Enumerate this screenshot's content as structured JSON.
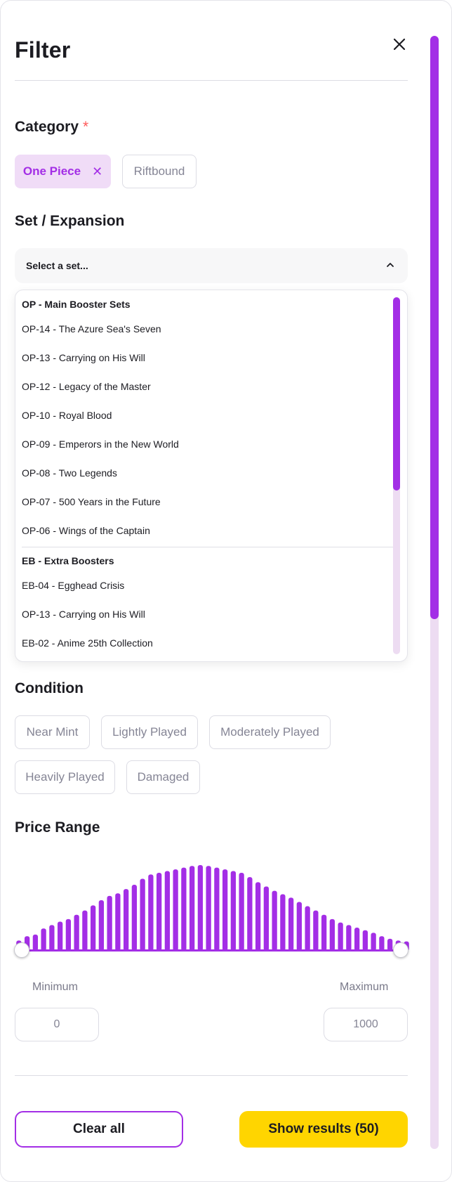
{
  "header": {
    "title": "Filter",
    "close_icon": "close-icon"
  },
  "category": {
    "title": "Category",
    "required_marker": "*",
    "chips": [
      {
        "label": "One Piece",
        "selected": true,
        "remove_glyph": "✕"
      },
      {
        "label": "Riftbound",
        "selected": false
      }
    ]
  },
  "set": {
    "title": "Set / Expansion",
    "placeholder": "Select a set...",
    "chevron_icon": "chevron-up-icon",
    "groups": [
      {
        "heading": "OP - Main Booster Sets",
        "options": [
          "OP-14 - The Azure Sea's Seven",
          "OP-13 - Carrying on His Will",
          "OP-12 - Legacy of the Master",
          "OP-10 - Royal Blood",
          "OP-09 - Emperors in the New World",
          "OP-08 - Two Legends",
          "OP-07 - 500 Years in the Future",
          "OP-06 - Wings of the Captain"
        ]
      },
      {
        "heading": "EB - Extra Boosters",
        "options": [
          "EB-04 - Egghead Crisis",
          "OP-13 - Carrying on His Will",
          "EB-02 - Anime 25th Collection"
        ]
      }
    ]
  },
  "condition": {
    "title": "Condition",
    "options": [
      "Near Mint",
      "Lightly Played",
      "Moderately Played",
      "Heavily Played",
      "Damaged"
    ]
  },
  "price": {
    "title": "Price Range",
    "min_label": "Minimum",
    "max_label": "Maximum",
    "min_value": "0",
    "max_value": "1000",
    "histogram": [
      0.12,
      0.17,
      0.19,
      0.26,
      0.3,
      0.34,
      0.37,
      0.42,
      0.47,
      0.53,
      0.59,
      0.64,
      0.67,
      0.72,
      0.77,
      0.84,
      0.89,
      0.91,
      0.93,
      0.95,
      0.97,
      0.99,
      1.0,
      0.99,
      0.97,
      0.95,
      0.93,
      0.91,
      0.86,
      0.8,
      0.75,
      0.7,
      0.66,
      0.62,
      0.57,
      0.52,
      0.47,
      0.42,
      0.37,
      0.33,
      0.3,
      0.27,
      0.24,
      0.21,
      0.17,
      0.14,
      0.12,
      0.11
    ],
    "accent_color": "#a32ee6"
  },
  "footer": {
    "clear_label": "Clear all",
    "show_label": "Show results (50)"
  },
  "colors": {
    "accent": "#a32ee6",
    "accent_light": "#f0dcf7",
    "cta": "#ffd500",
    "required": "#ff5a5a"
  }
}
